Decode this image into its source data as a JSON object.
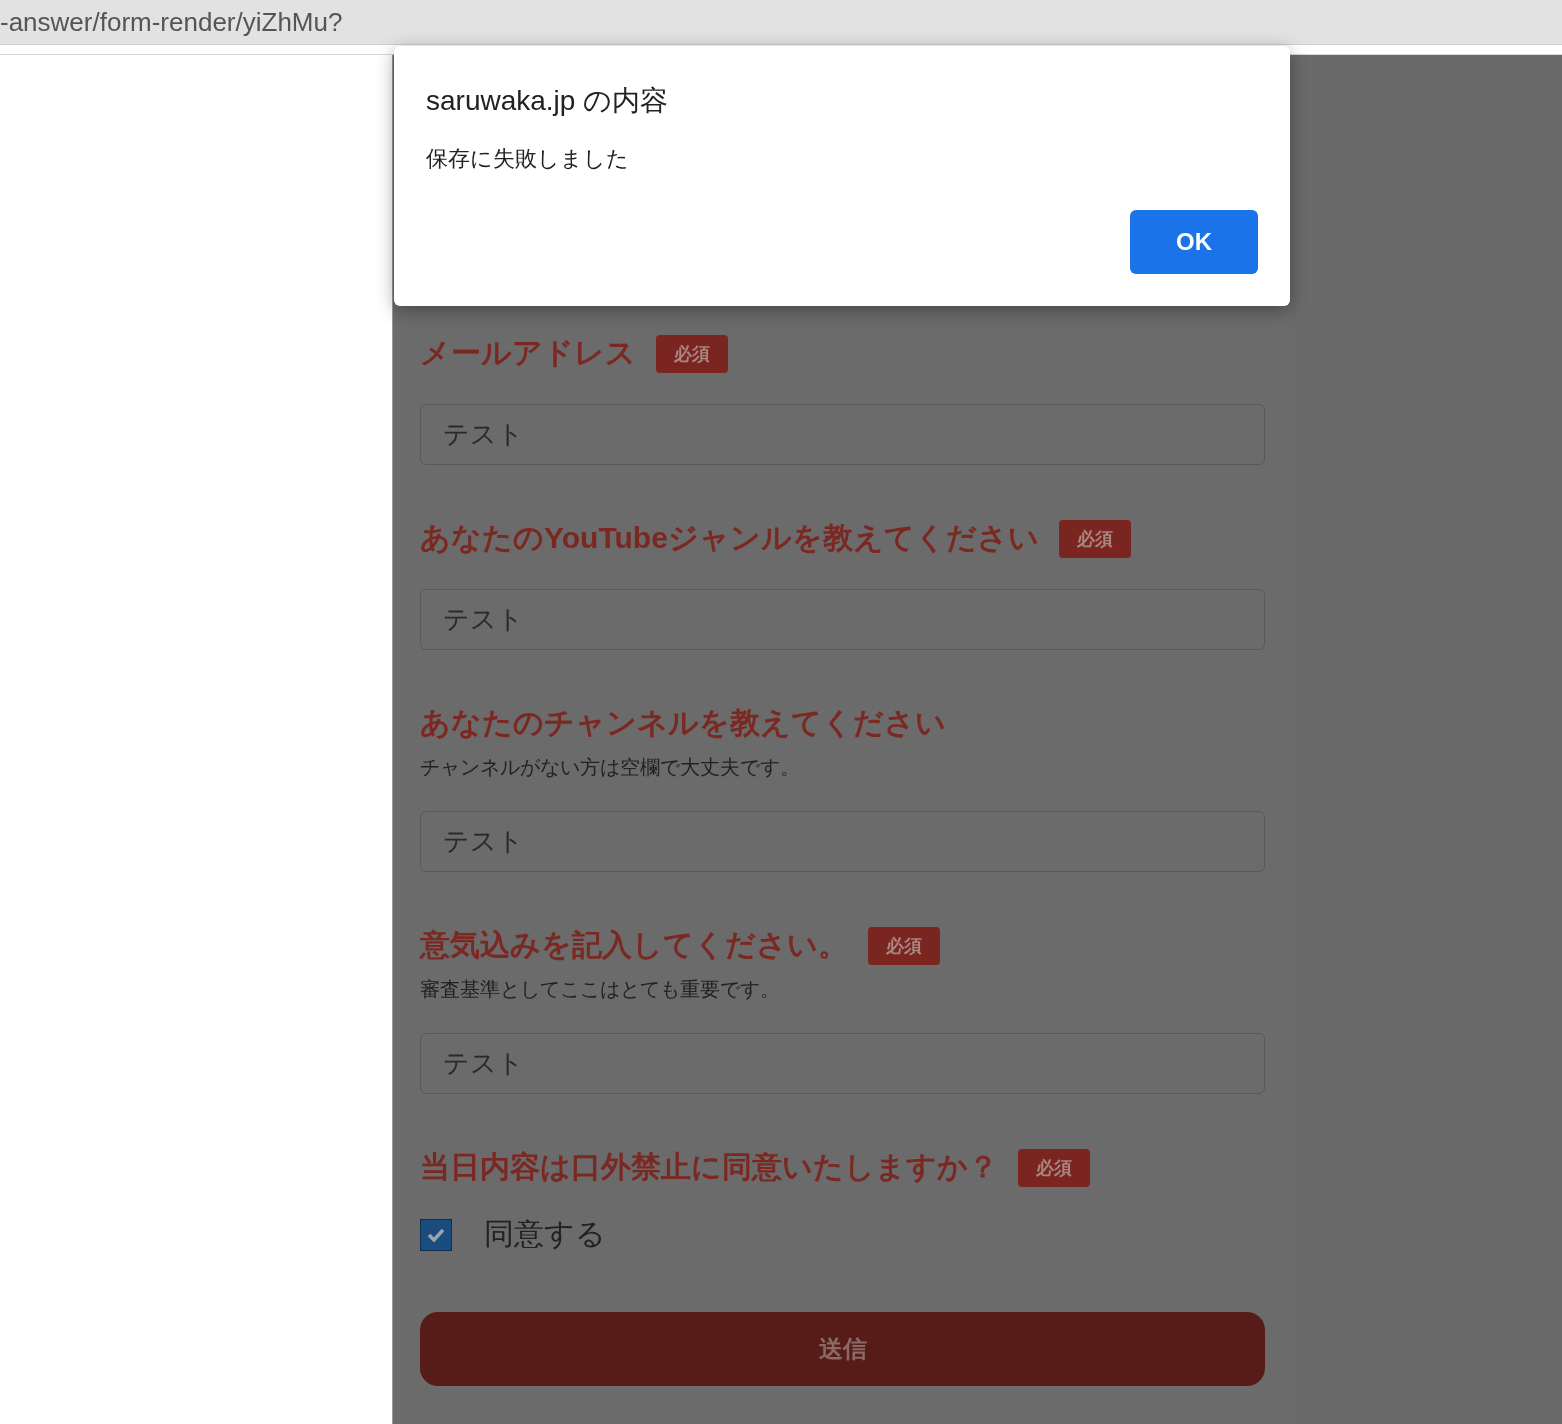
{
  "address_bar": {
    "url": "-answer/form-render/yiZhMu?"
  },
  "dialog": {
    "title": "saruwaka.jp の内容",
    "message": "保存に失敗しました",
    "button": "OK"
  },
  "questions": [
    {
      "kind": "text",
      "label": "メールアドレス",
      "badge": "必須",
      "value": "テスト"
    },
    {
      "kind": "text",
      "label": "あなたのYouTubeジャンルを教えてください",
      "badge": "必須",
      "value": "テスト"
    },
    {
      "kind": "text",
      "label": "あなたのチャンネルを教えてください",
      "note": "チャンネルがない方は空欄で大丈夫です。",
      "value": "テスト"
    },
    {
      "kind": "text",
      "label": "意気込みを記入してください。",
      "badge": "必須",
      "note": "審査基準としてここはとても重要です。",
      "value": "テスト"
    },
    {
      "kind": "checkbox",
      "label": "当日内容は口外禁止に同意いたしますか？",
      "badge": "必須",
      "option": {
        "label": "同意する",
        "checked": true
      }
    }
  ],
  "submit": "送信"
}
